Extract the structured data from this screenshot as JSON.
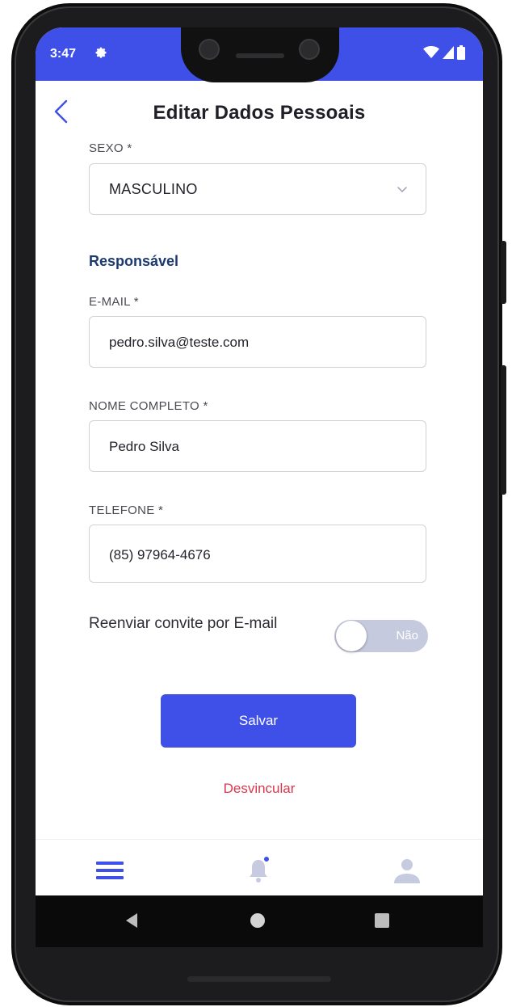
{
  "status_bar": {
    "time": "3:47",
    "color": "#3f50e8"
  },
  "header": {
    "title": "Editar Dados Pessoais",
    "back_icon": "chevron-left-icon"
  },
  "form": {
    "sexo": {
      "label": "SEXO *",
      "value": "MASCULINO"
    },
    "section_title": "Responsável",
    "email": {
      "label": "E-MAIL *",
      "value": "pedro.silva@teste.com"
    },
    "nome": {
      "label": "NOME COMPLETO *",
      "value": "Pedro Silva"
    },
    "telefone": {
      "label": "TELEFONE *",
      "value": "(85) 97964-4676"
    },
    "reenviar": {
      "label": "Reenviar convite por E-mail",
      "toggle_text": "Não",
      "on": false
    }
  },
  "actions": {
    "save_label": "Salvar",
    "unlink_label": "Desvincular"
  },
  "bottom_nav": {
    "items": [
      {
        "icon": "menu-icon",
        "active": true
      },
      {
        "icon": "bell-icon",
        "active": false
      },
      {
        "icon": "user-icon",
        "active": false
      }
    ]
  },
  "colors": {
    "primary": "#3f50e8",
    "danger": "#d8384c",
    "section": "#1d3a6e"
  }
}
